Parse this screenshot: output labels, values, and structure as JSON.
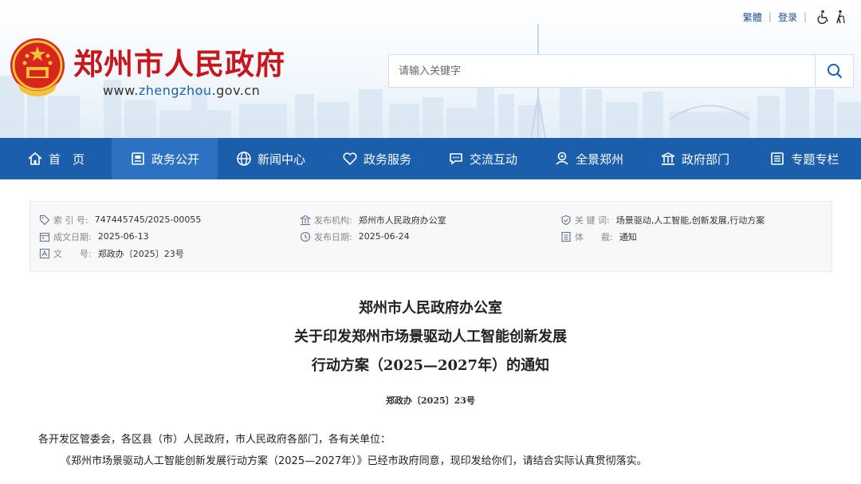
{
  "header": {
    "site_title": "郑州市人民政府",
    "url_prefix": "www.",
    "url_highlight": "zhengzhou",
    "url_suffix": ".gov.cn",
    "traditional_label": "繁體",
    "login_label": "登录",
    "accessibility_icon": "wheelchair-icon",
    "elderly_icon": "elderly-icon"
  },
  "search": {
    "placeholder": "请输入关键字",
    "button_icon": "search-icon"
  },
  "nav": {
    "items": [
      {
        "label": "首　页",
        "icon": "home-icon"
      },
      {
        "label": "政务公开",
        "icon": "document-icon"
      },
      {
        "label": "新闻中心",
        "icon": "globe-icon"
      },
      {
        "label": "政务服务",
        "icon": "heart-icon"
      },
      {
        "label": "交流互动",
        "icon": "chat-icon"
      },
      {
        "label": "全景郑州",
        "icon": "panorama-icon"
      },
      {
        "label": "政府部门",
        "icon": "building-icon"
      },
      {
        "label": "专题专栏",
        "icon": "list-icon"
      }
    ],
    "active_index": 1
  },
  "meta": {
    "index_label": "索 引 号:",
    "index_value": "747445745/2025-00055",
    "created_label": "成文日期:",
    "created_value": "2025-06-13",
    "docno_label": "文　　号:",
    "docno_value": "郑政办〔2025〕23号",
    "issuer_label": "发布机构:",
    "issuer_value": "郑州市人民政府办公室",
    "published_label": "发布日期:",
    "published_value": "2025-06-24",
    "keywords_label": "关 键 词:",
    "keywords_value": "场景驱动,人工智能,创新发展,行动方案",
    "genre_label": "体　　裁:",
    "genre_value": "通知"
  },
  "document": {
    "title_line1": "郑州市人民政府办公室",
    "title_line2": "关于印发郑州市场景驱动人工智能创新发展",
    "title_line3": "行动方案（2025—2027年）的通知",
    "doc_number": "郑政办〔2025〕23号",
    "salutation": "各开发区管委会，各区县（市）人民政府，市人民政府各部门，各有关单位：",
    "body_para1": "《郑州市场景驱动人工智能创新发展行动方案（2025—2027年）》已经市政府同意，现印发给你们，请结合实际认真贯彻落实。"
  },
  "colors": {
    "brand_red": "#c8161d",
    "nav_blue": "#1b5eab",
    "nav_active": "#2d72c2"
  }
}
